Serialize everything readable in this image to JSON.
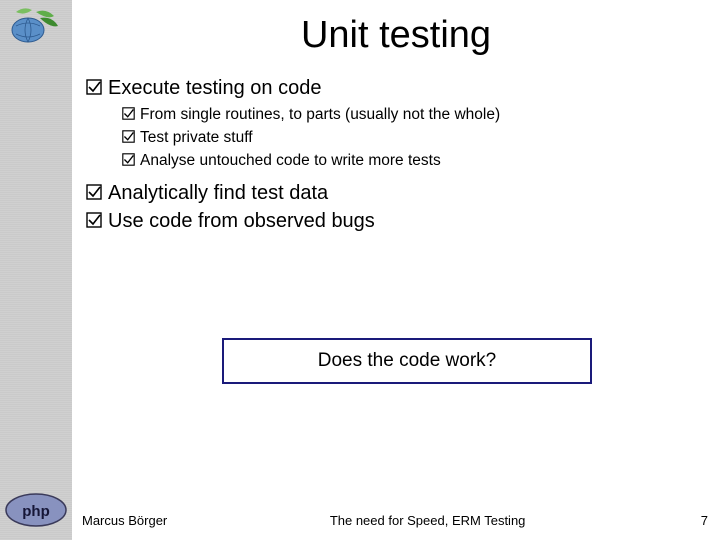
{
  "title": "Unit testing",
  "bullets": {
    "b1": "Execute testing on code",
    "b1_sub": {
      "s1": "From single routines, to parts (usually not the whole)",
      "s2": "Test private stuff",
      "s3": "Analyse untouched code to write more tests"
    },
    "b2": "Analytically find test data",
    "b3": "Use code from observed bugs"
  },
  "question": "Does the code work?",
  "footer": {
    "author": "Marcus Börger",
    "center": "The need for Speed, ERM Testing",
    "page": "7"
  },
  "icons": {
    "top_logo": "stylized-globe-leaves",
    "bottom_logo": "php-logo",
    "bullet": "checkbox-checked"
  }
}
